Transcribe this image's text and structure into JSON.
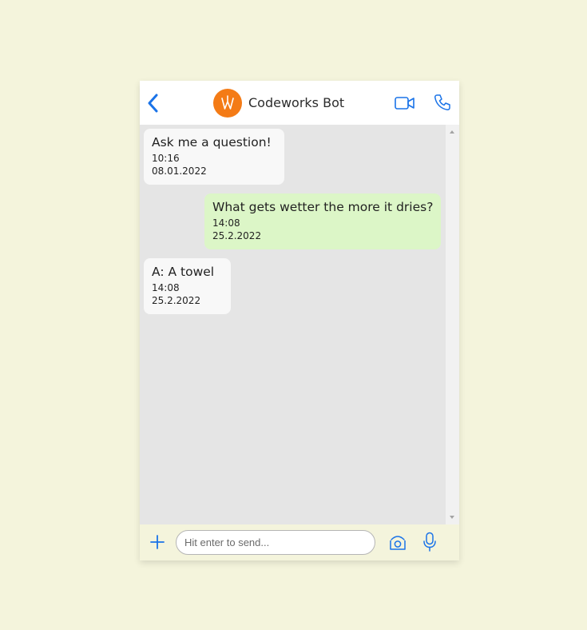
{
  "header": {
    "bot_name": "Codeworks Bot",
    "icons": {
      "back": "chevron-left-icon",
      "avatar": "codeworks-logo",
      "video": "video-camera-icon",
      "phone": "phone-icon"
    }
  },
  "messages": [
    {
      "sender": "bot",
      "text": "Ask me a question!",
      "time": "10:16",
      "date": "08.01.2022"
    },
    {
      "sender": "user",
      "text": "What gets wetter the more it dries?",
      "time": "14:08",
      "date": "25.2.2022"
    },
    {
      "sender": "bot",
      "text": "A: A towel",
      "time": "14:08",
      "date": "25.2.2022"
    }
  ],
  "input": {
    "placeholder": "Hit enter to send...",
    "value": "",
    "icons": {
      "add": "plus-icon",
      "camera": "camera-icon",
      "mic": "microphone-icon"
    }
  },
  "colors": {
    "page_background": "#f4f4dc",
    "accent": "#1a73e8",
    "avatar": "#f47b16",
    "bot_bubble": "#f8f8f8",
    "user_bubble": "#dcf6c7",
    "chat_background": "#e5e5e5"
  }
}
